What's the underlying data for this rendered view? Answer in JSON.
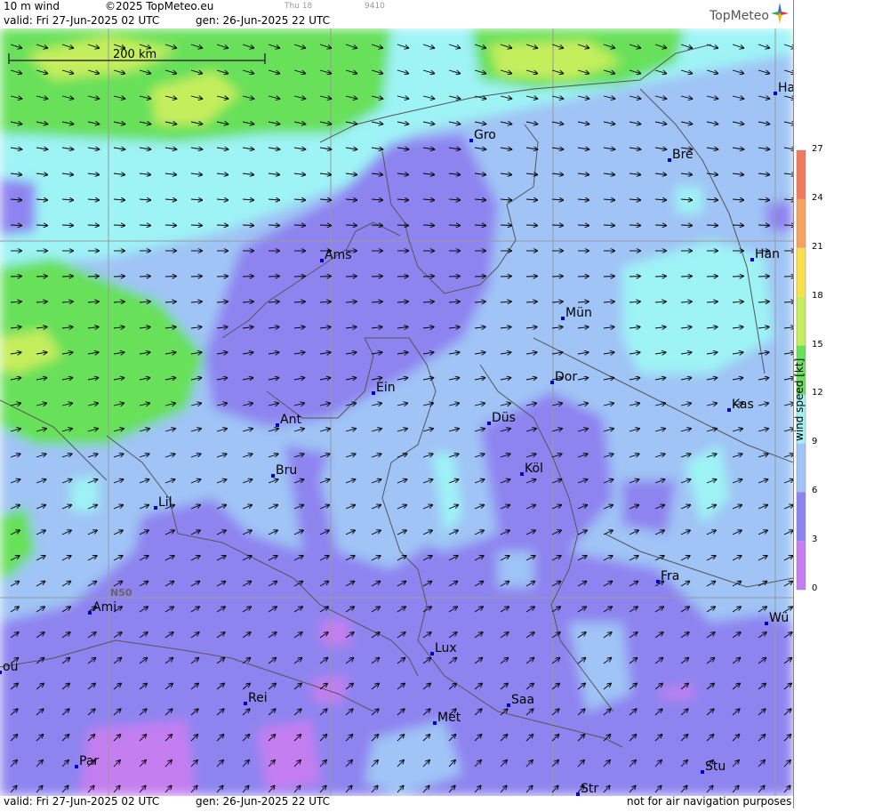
{
  "header": {
    "product": "10 m wind",
    "copyright": "©2025 TopMeteo.eu",
    "faint_day": "Thu 18",
    "faint_code": "9410",
    "valid": "valid:  Fri  27-Jun-2025  02 UTC",
    "gen": "gen: 26-Jun-2025 22 UTC",
    "logo": "TopMeteo"
  },
  "footer": {
    "valid": "valid:  Fri  27-Jun-2025  02 UTC",
    "gen": "gen: 26-Jun-2025 22 UTC",
    "disclaimer": "not for air navigation purposes"
  },
  "map": {
    "scale_label": "200 km",
    "lat_label": "N50",
    "cities": [
      {
        "name": "Gro"
      },
      {
        "name": "Bre"
      },
      {
        "name": "Ha"
      },
      {
        "name": "Ams"
      },
      {
        "name": "Han"
      },
      {
        "name": "Mün"
      },
      {
        "name": "Dor"
      },
      {
        "name": "Ein"
      },
      {
        "name": "Kas"
      },
      {
        "name": "Ant"
      },
      {
        "name": "Düs"
      },
      {
        "name": "Bru"
      },
      {
        "name": "Köl"
      },
      {
        "name": "Lil"
      },
      {
        "name": "Fra"
      },
      {
        "name": "Ami"
      },
      {
        "name": "Wü"
      },
      {
        "name": "ou"
      },
      {
        "name": "Lux"
      },
      {
        "name": "Rei"
      },
      {
        "name": "Saa"
      },
      {
        "name": "Met"
      },
      {
        "name": "Par"
      },
      {
        "name": "Stu"
      },
      {
        "name": "Str"
      }
    ]
  },
  "legend": {
    "title": "wind  speed  [kt]",
    "ticks": [
      "27",
      "24",
      "21",
      "18",
      "15",
      "12",
      "9",
      "6",
      "3",
      "0"
    ],
    "colors": [
      "#f07a5c",
      "#f5a45f",
      "#fbe04e",
      "#c5ee5d",
      "#67e05a",
      "#9ef3f5",
      "#9fc4f5",
      "#8e84f0",
      "#c57ef0"
    ],
    "bands": [
      {
        "from": 0,
        "to": 3,
        "color": "#c57ef0"
      },
      {
        "from": 3,
        "to": 6,
        "color": "#8e84f0"
      },
      {
        "from": 6,
        "to": 9,
        "color": "#9fc4f5"
      },
      {
        "from": 9,
        "to": 12,
        "color": "#9ef3f5"
      },
      {
        "from": 12,
        "to": 15,
        "color": "#67e05a"
      },
      {
        "from": 15,
        "to": 18,
        "color": "#c5ee5d"
      },
      {
        "from": 18,
        "to": 21,
        "color": "#fbe04e"
      },
      {
        "from": 21,
        "to": 24,
        "color": "#f5a45f"
      },
      {
        "from": 24,
        "to": 27,
        "color": "#f07a5c"
      }
    ]
  }
}
